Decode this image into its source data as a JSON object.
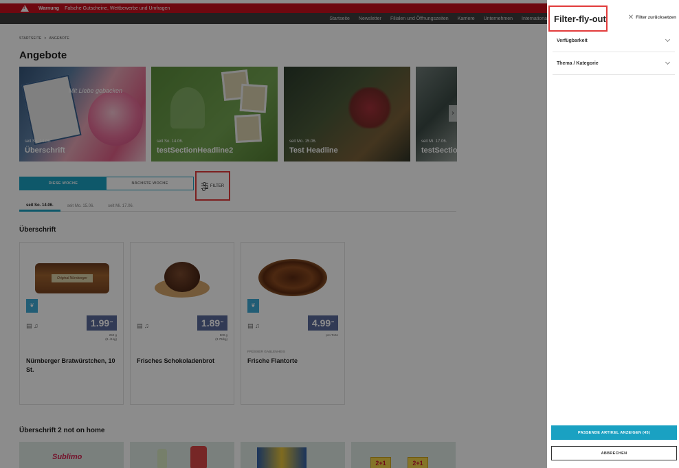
{
  "warning": {
    "label": "Warnung",
    "text": "Falsche Gutscheine, Wettbewerbe und Umfragen"
  },
  "topnav": [
    "Startseite",
    "Newsletter",
    "Filialen und Öffnungszeiten",
    "Karriere",
    "Unternehmen",
    "Internationa"
  ],
  "breadcrumb": {
    "home": "STARTSEITE",
    "sep": ">",
    "current": "ANGEBOTE"
  },
  "page_title": "Angebote",
  "teasers": [
    {
      "date": "seit So. 14.06.",
      "headline": "Überschrift",
      "script": "Mit Liebe gebacken"
    },
    {
      "date": "seit So. 14.06.",
      "headline": "testSectionHeadline2"
    },
    {
      "date": "seit Mo. 15.06.",
      "headline": "Test Headline"
    },
    {
      "date": "seit Mi. 17.06.",
      "headline": "testSection"
    }
  ],
  "week_switch": {
    "this_week": "DIESE WOCHE",
    "next_week": "NÄCHSTE WOCHE"
  },
  "filter_button": "FILTER",
  "day_tabs": [
    "seit So. 14.06.",
    "seit Mo. 15.06.",
    "seit Mi. 17.06."
  ],
  "section1": {
    "title": "Überschrift",
    "products": [
      {
        "name": "Nürnberger Bratwürstchen, 10 St.",
        "price": "1.99",
        "price_sup": "**",
        "unit_line1": "250 g",
        "unit_line2": "(8.-/1kg)",
        "brand": "",
        "pack_label": "Original Nürnberger"
      },
      {
        "name": "Frisches Schokoladenbrot",
        "price": "1.89",
        "price_sup": "**",
        "unit_line1": "500 g",
        "unit_line2": "(3.78/kg)",
        "brand": ""
      },
      {
        "name": "Frische Flantorte",
        "price": "4.99",
        "price_sup": "**",
        "unit_line1": "pro Torte",
        "unit_line2": "",
        "brand": "FRÜSSER GABLENHEIS"
      }
    ]
  },
  "section2": {
    "title": "Überschrift 2 not on home",
    "product1_label": "Sublimo",
    "promo_label": "2+1"
  },
  "flyout": {
    "title": "Filter-fly-out",
    "reset": "Filter zurücksetzen",
    "accordions": [
      "Verfügbarkeit",
      "Thema / Kategorie"
    ],
    "apply_button": "PASSENDE ARTIKEL ANZEIGEN (45)",
    "cancel_button": "ABBRECHEN"
  },
  "colors": {
    "accent": "#1aa1c2",
    "warning": "#c8101e",
    "price": "#5a6a9c",
    "highlight": "#e23b3b"
  }
}
